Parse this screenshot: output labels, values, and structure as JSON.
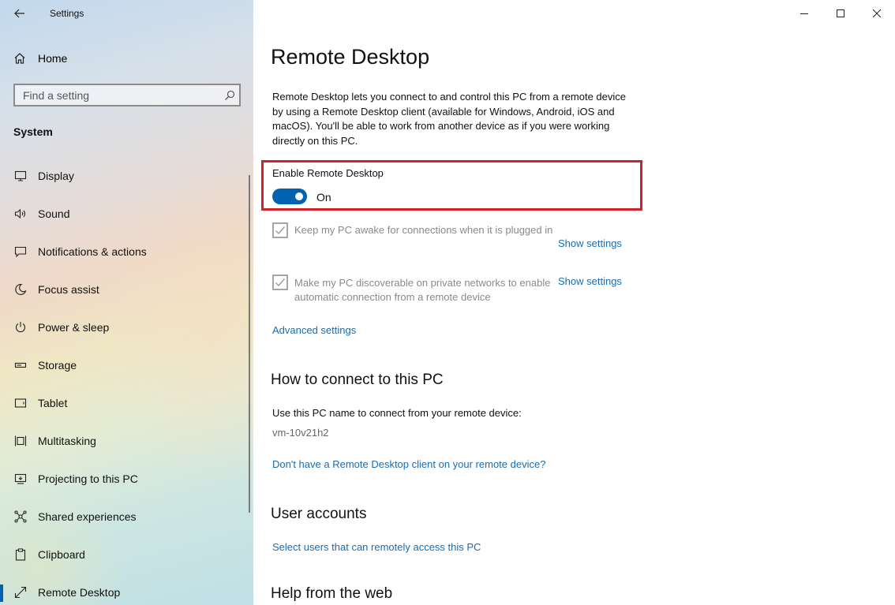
{
  "window": {
    "title": "Settings"
  },
  "sidebar": {
    "home_label": "Home",
    "search_placeholder": "Find a setting",
    "section_label": "System",
    "items": [
      {
        "label": "Display",
        "icon": "display-icon"
      },
      {
        "label": "Sound",
        "icon": "sound-icon"
      },
      {
        "label": "Notifications & actions",
        "icon": "notifications-icon"
      },
      {
        "label": "Focus assist",
        "icon": "focus-assist-icon"
      },
      {
        "label": "Power & sleep",
        "icon": "power-icon"
      },
      {
        "label": "Storage",
        "icon": "storage-icon"
      },
      {
        "label": "Tablet",
        "icon": "tablet-icon"
      },
      {
        "label": "Multitasking",
        "icon": "multitasking-icon"
      },
      {
        "label": "Projecting to this PC",
        "icon": "projecting-icon"
      },
      {
        "label": "Shared experiences",
        "icon": "shared-experiences-icon"
      },
      {
        "label": "Clipboard",
        "icon": "clipboard-icon"
      },
      {
        "label": "Remote Desktop",
        "icon": "remote-desktop-icon",
        "active": true
      }
    ]
  },
  "main": {
    "title": "Remote Desktop",
    "description": "Remote Desktop lets you connect to and control this PC from a remote device by using a Remote Desktop client (available for Windows, Android, iOS and macOS). You'll be able to work from another device as if you were working directly on this PC.",
    "enable": {
      "label": "Enable Remote Desktop",
      "state_text": "On",
      "on": true
    },
    "options": [
      {
        "text": "Keep my PC awake for connections when it is plugged in",
        "checked": true,
        "link": "Show settings"
      },
      {
        "text": "Make my PC discoverable on private networks to enable automatic connection from a remote device",
        "checked": true,
        "link": "Show settings"
      }
    ],
    "advanced_link": "Advanced settings",
    "connect": {
      "heading": "How to connect to this PC",
      "instruction": "Use this PC name to connect from your remote device:",
      "pc_name": "vm-10v21h2",
      "client_link": "Don't have a Remote Desktop client on your remote device?"
    },
    "accounts": {
      "heading": "User accounts",
      "link": "Select users that can remotely access this PC"
    },
    "help": {
      "heading": "Help from the web"
    }
  },
  "colors": {
    "accent": "#0063b1",
    "link": "#1b6cae",
    "highlight": "#d22128"
  }
}
